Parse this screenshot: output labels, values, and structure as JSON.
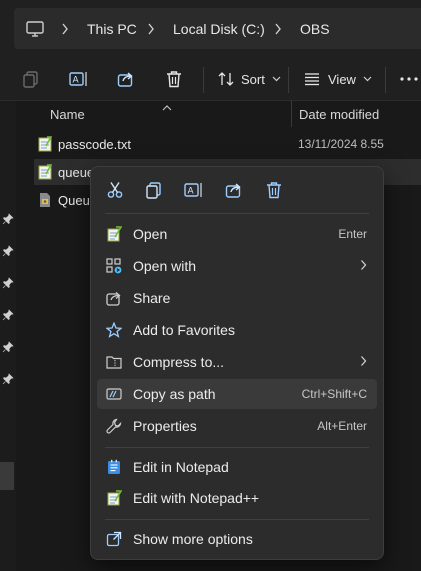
{
  "breadcrumb": {
    "items": [
      "This PC",
      "Local Disk (C:)",
      "OBS"
    ]
  },
  "toolbar": {
    "sort_label": "Sort",
    "view_label": "View"
  },
  "columns": {
    "name": "Name",
    "date_modified": "Date modified"
  },
  "files": [
    {
      "name": "passcode.txt",
      "date": "13/11/2024 8.55",
      "icon": "notepad-file-icon"
    },
    {
      "name": "queue",
      "date": "",
      "icon": "notepad-file-icon",
      "selected": true
    },
    {
      "name": "Queue",
      "date": "",
      "icon": "script-file-icon"
    }
  ],
  "context_menu": {
    "quick_actions": [
      "cut-icon",
      "copy-icon",
      "rename-icon",
      "share-icon",
      "delete-icon"
    ],
    "items": [
      {
        "label": "Open",
        "shortcut": "Enter",
        "icon": "notepad-icon"
      },
      {
        "label": "Open with",
        "shortcut": "",
        "icon": "open-with-icon",
        "submenu": true
      },
      {
        "label": "Share",
        "shortcut": "",
        "icon": "share-icon"
      },
      {
        "label": "Add to Favorites",
        "shortcut": "",
        "icon": "star-icon"
      },
      {
        "label": "Compress to...",
        "shortcut": "",
        "icon": "zip-folder-icon",
        "submenu": true
      },
      {
        "label": "Copy as path",
        "shortcut": "Ctrl+Shift+C",
        "icon": "copy-path-icon",
        "hover": true
      },
      {
        "label": "Properties",
        "shortcut": "Alt+Enter",
        "icon": "wrench-icon"
      },
      {
        "label": "Edit in Notepad",
        "shortcut": "",
        "icon": "notepad-blue-icon"
      },
      {
        "label": "Edit with Notepad++",
        "shortcut": "",
        "icon": "notepadpp-icon"
      },
      {
        "label": "Show more options",
        "shortcut": "",
        "icon": "external-icon"
      }
    ]
  },
  "colors": {
    "background": "#191919",
    "menu_bg": "#2c2c2c",
    "accent": "#4cc2ff"
  }
}
